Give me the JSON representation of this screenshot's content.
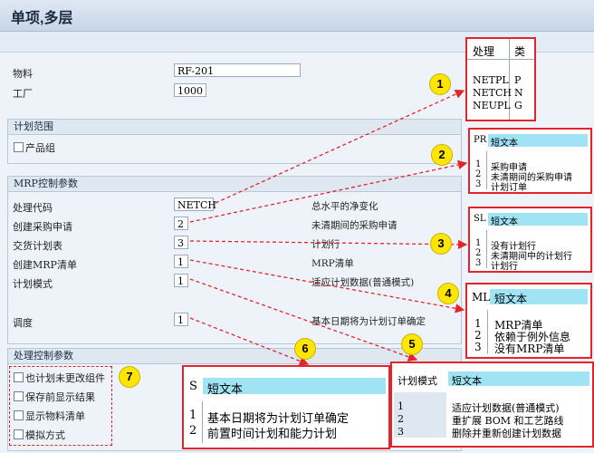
{
  "window": {
    "title": "单项,多层"
  },
  "header_fields": {
    "material_label": "物料",
    "material_value": "RF-201",
    "plant_label": "工厂",
    "plant_value": "1000"
  },
  "planning_scope": {
    "title": "计划范围",
    "product_group_label": "产品组"
  },
  "mrp_control": {
    "title": "MRP控制参数",
    "rows": [
      {
        "label": "处理代码",
        "value": "NETCH",
        "desc": "总水平的净变化"
      },
      {
        "label": "创建采购申请",
        "value": "2",
        "desc": "未清期间的采购申请"
      },
      {
        "label": "交货计划表",
        "value": "3",
        "desc": "计划行"
      },
      {
        "label": "创建MRP清单",
        "value": "1",
        "desc": "MRP清单"
      },
      {
        "label": "计划模式",
        "value": "1",
        "desc": "适应计划数据(普通模式)"
      },
      {
        "label": "调度",
        "value": "1",
        "desc": "基本日期将为计划订单确定"
      }
    ]
  },
  "process_control": {
    "title": "处理控制参数",
    "checkboxes": [
      "也计划未更改组件",
      "保存前显示结果",
      "显示物料清单",
      "模拟方式"
    ]
  },
  "callouts": [
    "1",
    "2",
    "3",
    "4",
    "5",
    "6",
    "7"
  ],
  "popups": {
    "p1": {
      "headers": [
        "处理",
        "类"
      ],
      "rows": [
        [
          "NETPL",
          "P"
        ],
        [
          "NETCH",
          "N"
        ],
        [
          "NEUPL",
          "G"
        ]
      ]
    },
    "p2": {
      "headers": [
        "PR",
        "短文本"
      ],
      "rows": [
        [
          "1",
          "采购申请"
        ],
        [
          "2",
          "未清期间的采购申请"
        ],
        [
          "3",
          "计划订单"
        ]
      ]
    },
    "p3": {
      "headers": [
        "SL",
        "短文本"
      ],
      "rows": [
        [
          "1",
          "没有计划行"
        ],
        [
          "2",
          "未清期间中的计划行"
        ],
        [
          "3",
          "计划行"
        ]
      ]
    },
    "p4": {
      "headers": [
        "ML",
        "短文本"
      ],
      "rows": [
        [
          "1",
          "MRP清单"
        ],
        [
          "2",
          "依赖于例外信息"
        ],
        [
          "3",
          "没有MRP清单"
        ]
      ]
    },
    "p5": {
      "headers": [
        "计划模式",
        "短文本"
      ],
      "rows": [
        [
          "1",
          "适应计划数据(普通模式)"
        ],
        [
          "2",
          "重扩展 BOM 和工艺路线"
        ],
        [
          "3",
          "删除并重新创建计划数据"
        ]
      ]
    },
    "p6": {
      "headers": [
        "S",
        "短文本"
      ],
      "rows": [
        [
          "1",
          "基本日期将为计划订单确定"
        ],
        [
          "2",
          "前置时间计划和能力计划"
        ]
      ]
    }
  },
  "colors": {
    "callout_line": "#e3242b",
    "badge": "#ffe600",
    "popup_header": "#9fe3f5"
  }
}
